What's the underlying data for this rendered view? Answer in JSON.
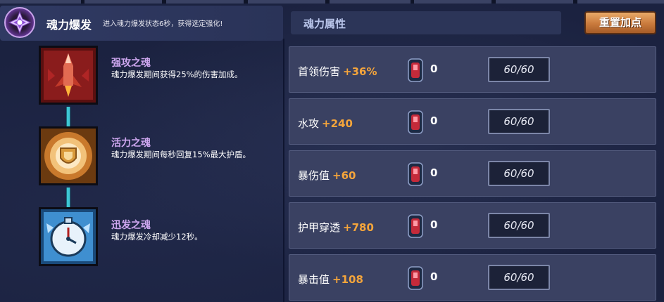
{
  "skill": {
    "title": "魂力爆发",
    "description": "进入魂力爆发状态6秒，获得选定强化!",
    "icon": "soul-burst-emblem-icon"
  },
  "souls": [
    {
      "name": "强攻之魂",
      "text": "魂力爆发期间获得25%的伤害加成。",
      "icon": "rocket-soul-icon",
      "color": "#b3242a"
    },
    {
      "name": "活力之魂",
      "text": "魂力爆发期间每秒回复15%最大护盾。",
      "icon": "shield-soul-icon",
      "color": "#d98a2e"
    },
    {
      "name": "迅发之魂",
      "text": "魂力爆发冷却减少12秒。",
      "icon": "clock-soul-icon",
      "color": "#4a9ed8"
    }
  ],
  "attributes_header": "魂力属性",
  "reset_button": "重置加点",
  "attributes": [
    {
      "name": "首领伤害",
      "bonus": "+36%",
      "count": "0",
      "level": "60/60"
    },
    {
      "name": "水攻",
      "bonus": "+240",
      "count": "0",
      "level": "60/60"
    },
    {
      "name": "暴伤值",
      "bonus": "+60",
      "count": "0",
      "level": "60/60"
    },
    {
      "name": "护甲穿透",
      "bonus": "+780",
      "count": "0",
      "level": "60/60"
    },
    {
      "name": "暴击值",
      "bonus": "+108",
      "count": "0",
      "level": "60/60"
    }
  ],
  "colors": {
    "background": "#1b2240",
    "accent_orange": "#f5a53b",
    "soul_name": "#cda6ef",
    "connector": "#3ec6d4",
    "button": "#c97a3c"
  }
}
